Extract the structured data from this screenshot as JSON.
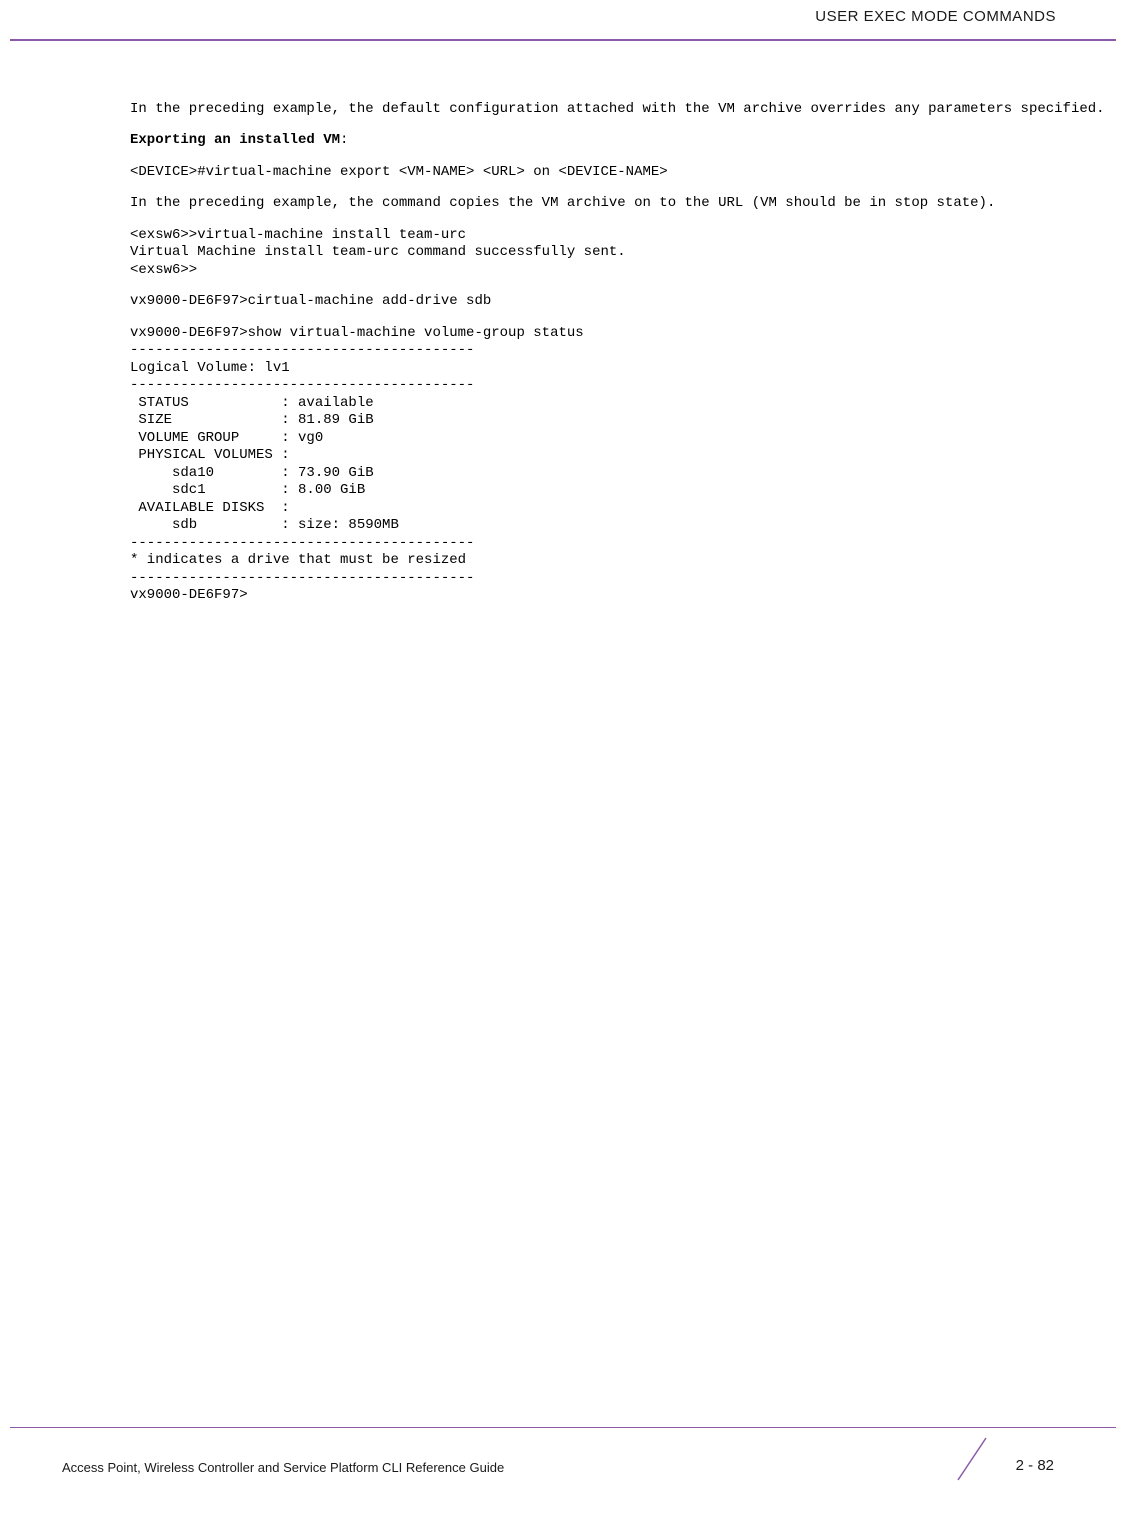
{
  "header": {
    "title": "USER EXEC MODE COMMANDS"
  },
  "content": {
    "para1": "In the preceding example, the default configuration attached with the VM archive overrides any parameters specified.",
    "heading1": "Exporting an installed VM",
    "heading1_suffix": ":",
    "cmd1": "<DEVICE>#virtual-machine export <VM-NAME> <URL> on <DEVICE-NAME>",
    "para2": "In the preceding example, the command copies the VM archive on to the URL (VM should be in stop state).",
    "block1": "<exsw6>>virtual-machine install team-urc\nVirtual Machine install team-urc command successfully sent.\n<exsw6>>",
    "cmd2": "vx9000-DE6F97>cirtual-machine add-drive sdb",
    "block2": "vx9000-DE6F97>show virtual-machine volume-group status\n-----------------------------------------\nLogical Volume: lv1\n-----------------------------------------\n STATUS           : available\n SIZE             : 81.89 GiB\n VOLUME GROUP     : vg0\n PHYSICAL VOLUMES :\n     sda10        : 73.90 GiB\n     sdc1         : 8.00 GiB\n AVAILABLE DISKS  :\n     sdb          : size: 8590MB\n-----------------------------------------\n* indicates a drive that must be resized\n-----------------------------------------\nvx9000-DE6F97>"
  },
  "footer": {
    "left": "Access Point, Wireless Controller and Service Platform CLI Reference Guide",
    "page": "2 - 82"
  }
}
